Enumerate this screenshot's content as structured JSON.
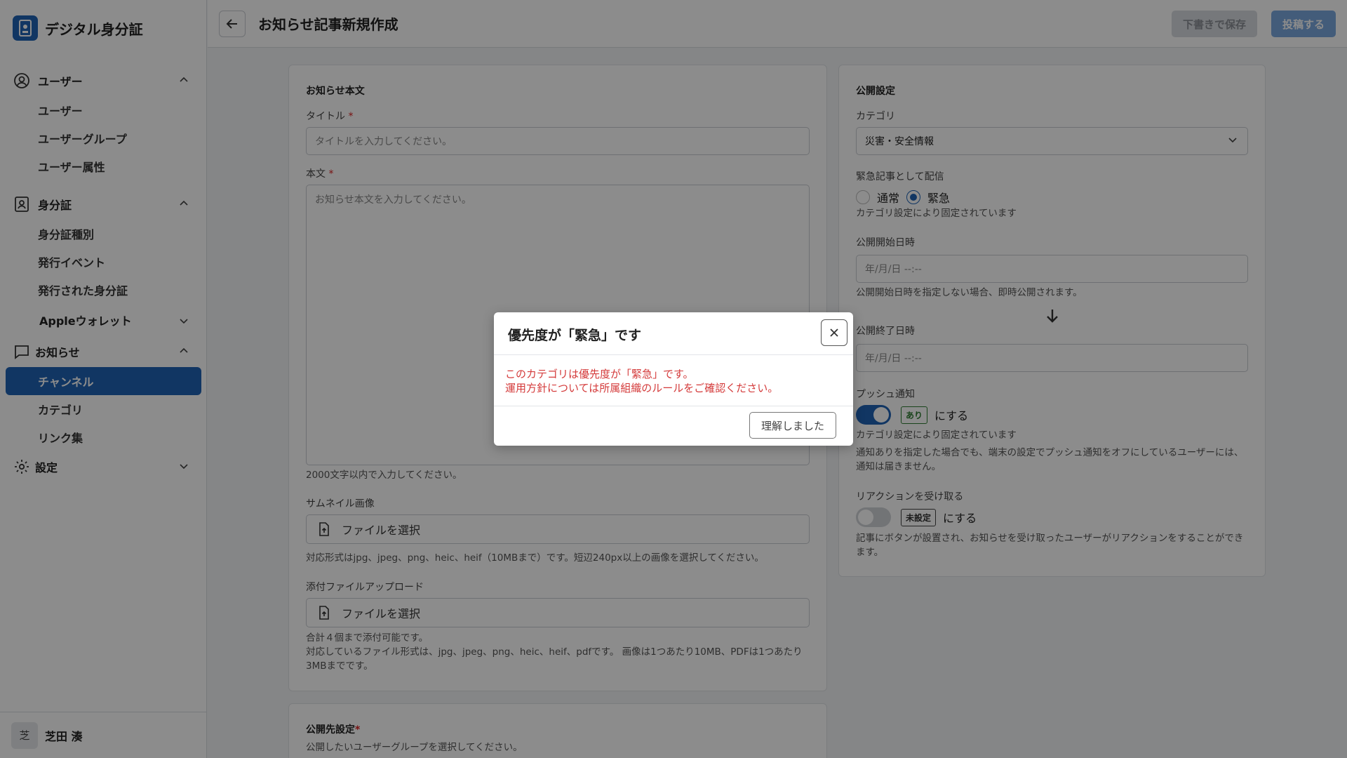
{
  "app": {
    "title": "デジタル身分証"
  },
  "sidebar": {
    "groups": [
      {
        "label": "ユーザー",
        "items": [
          "ユーザー",
          "ユーザーグループ",
          "ユーザー属性"
        ]
      },
      {
        "label": "身分証",
        "items": [
          "身分証種別",
          "発行イベント",
          "発行された身分証"
        ],
        "sub": "Appleウォレット"
      },
      {
        "label": "お知らせ",
        "items": [
          "チャンネル",
          "カテゴリ",
          "リンク集"
        ]
      },
      {
        "label": "設定"
      }
    ],
    "user": {
      "initial": "芝",
      "name": "芝田 湊"
    }
  },
  "header": {
    "title": "お知らせ記事新規作成",
    "draft_label": "下書きで保存",
    "post_label": "投稿する"
  },
  "main": {
    "section_title": "お知らせ本文",
    "title_label": "タイトル",
    "title_placeholder": "タイトルを入力してください。",
    "body_label": "本文",
    "body_placeholder": "お知らせ本文を入力してください。",
    "body_hint": "2000文字以内で入力してください。",
    "thumb_label": "サムネイル画像",
    "thumb_button": "ファイルを選択",
    "thumb_hint": "対応形式はjpg、jpeg、png、heic、heif（10MBまで）です。短辺240px以上の画像を選択してください。",
    "attach_label": "添付ファイルアップロード",
    "attach_button": "ファイルを選択",
    "attach_hint1": "合計４個まで添付可能です。",
    "attach_hint2": "対応しているファイル形式は、jpg、jpeg、png、heic、heif、pdfです。 画像は1つあたり10MB、PDFは1つあたり3MBまでです。",
    "target_title": "公開先設定",
    "target_hint": "公開したいユーザーグループを選択してください。"
  },
  "publish": {
    "section_title": "公開設定",
    "category_label": "カテゴリ",
    "category_value": "災害・安全情報",
    "urgent_label": "緊急記事として配信",
    "radio_normal": "通常",
    "radio_urgent": "緊急",
    "urgent_fixed": "カテゴリ設定により固定されています",
    "start_label": "公開開始日時",
    "start_placeholder": "年/月/日 --:--",
    "start_hint": "公開開始日時を指定しない場合、即時公開されます。",
    "end_label": "公開終了日時",
    "end_placeholder": "年/月/日 --:--",
    "push_label": "プッシュ通知",
    "push_tag": "あり",
    "push_suffix": "にする",
    "push_fixed": "カテゴリ設定により固定されています",
    "push_hint": "通知ありを指定した場合でも、端末の設定でプッシュ通知をオフにしているユーザーには、通知は届きません。",
    "reaction_label": "リアクションを受け取る",
    "reaction_tag": "未設定",
    "reaction_suffix": "にする",
    "reaction_hint": "記事にボタンが設置され、お知らせを受け取ったユーザーがリアクションをすることができます。"
  },
  "modal": {
    "title": "優先度が「緊急」です",
    "line1": "このカテゴリは優先度が「緊急」です。",
    "line2": "運用方針については所属組織のルールをご確認ください。",
    "ok_label": "理解しました"
  },
  "colors": {
    "primary": "#1f63b4",
    "danger": "#d43a3a",
    "success": "#2f7d32"
  }
}
